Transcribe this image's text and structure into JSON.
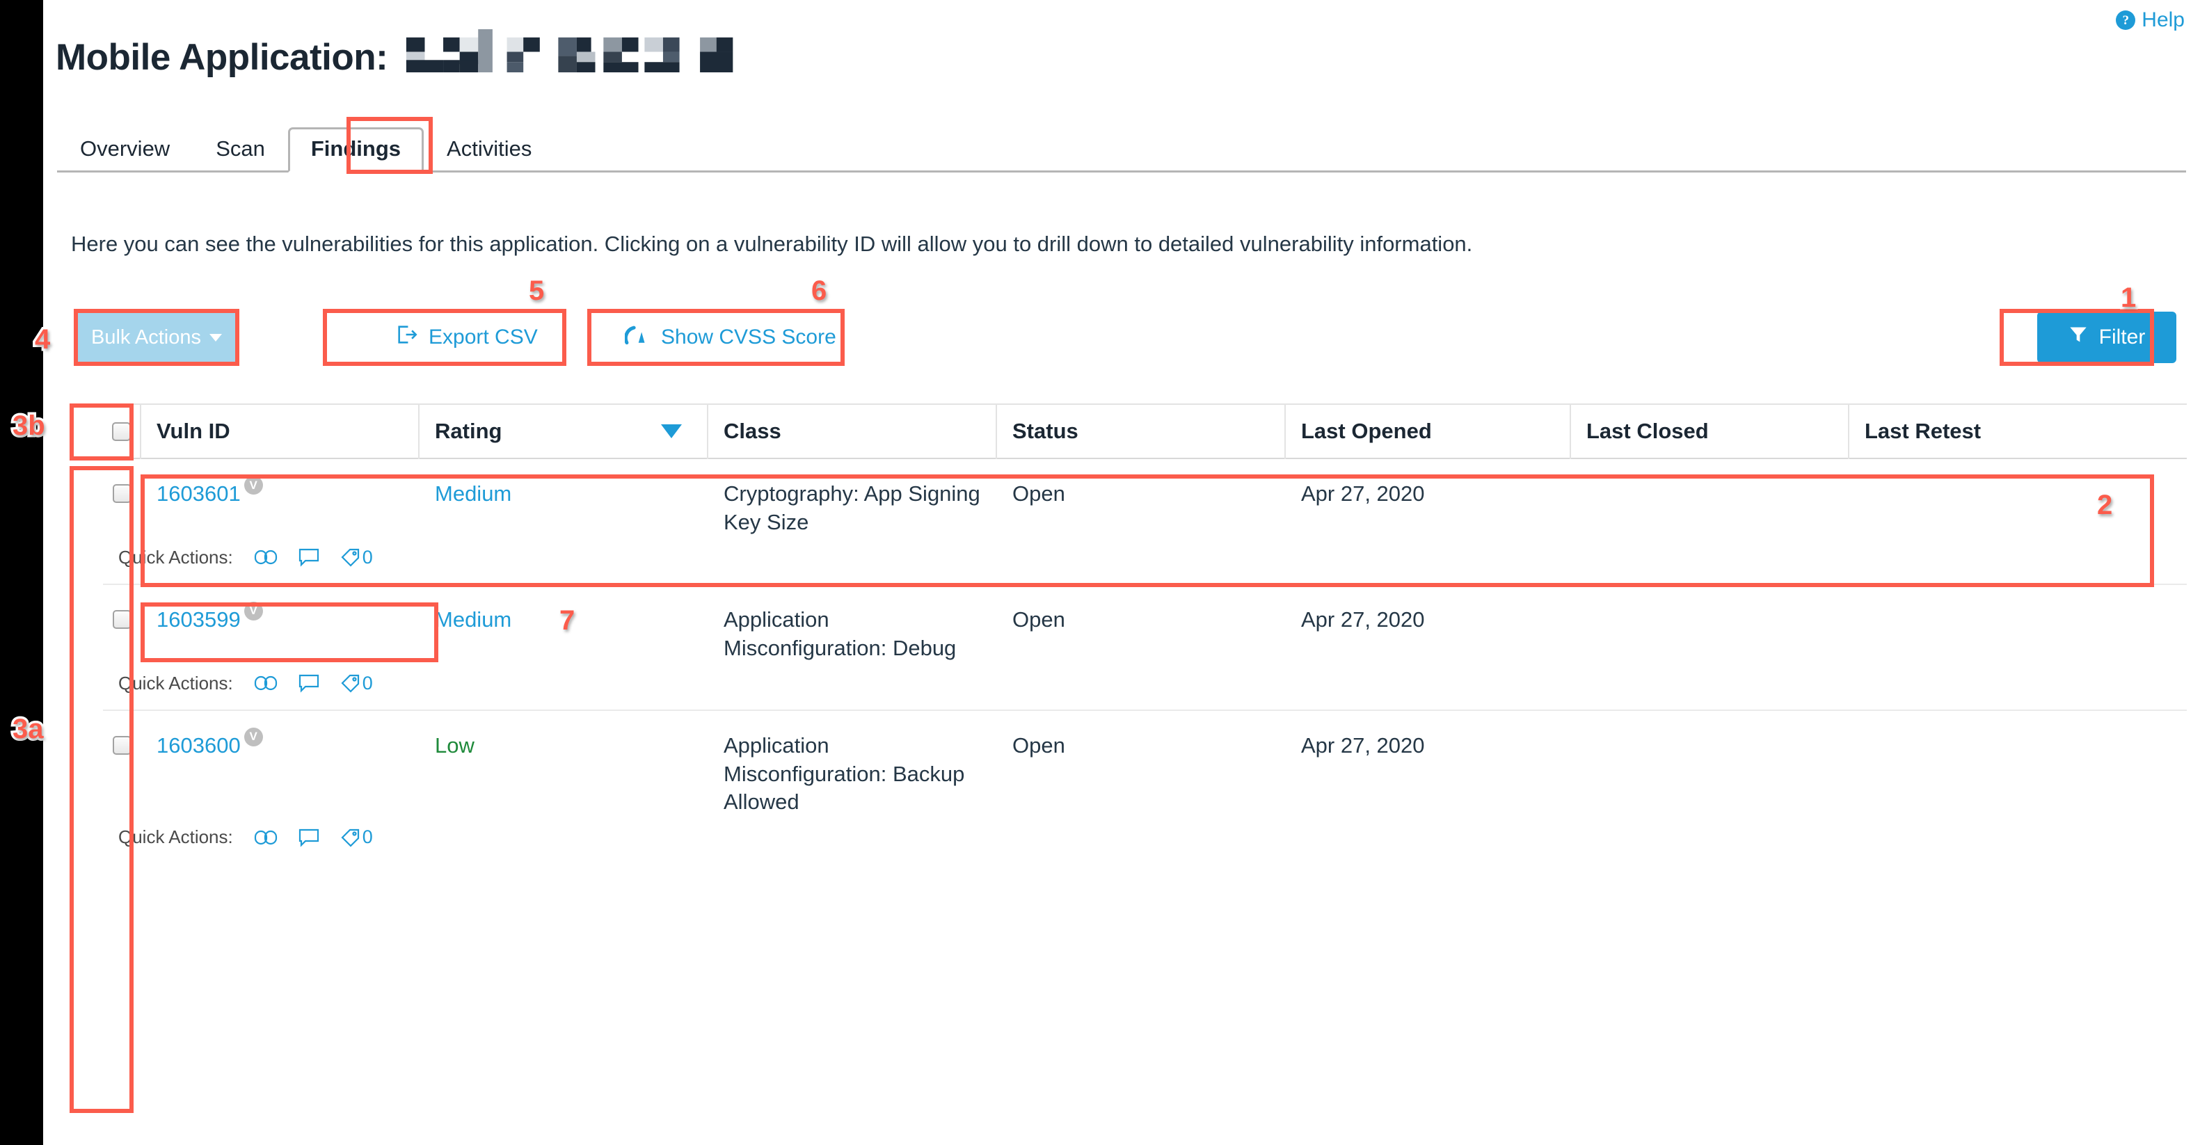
{
  "header": {
    "title_prefix": "Mobile Application:",
    "title_redacted": true,
    "help_label": "Help",
    "help_icon": "question-circle-icon"
  },
  "tabs": [
    {
      "label": "Overview",
      "active": false
    },
    {
      "label": "Scan",
      "active": false
    },
    {
      "label": "Findings",
      "active": true
    },
    {
      "label": "Activities",
      "active": false
    }
  ],
  "description": "Here you can see the vulnerabilities for this application. Clicking on a vulnerability ID will allow you to drill down to detailed vulnerability information.",
  "toolbar": {
    "bulk_actions_label": "Bulk Actions",
    "bulk_actions_caret": "caret-down-icon",
    "export_csv_label": "Export CSV",
    "export_csv_icon": "export-icon",
    "show_cvss_label": "Show CVSS Score",
    "show_cvss_icon": "speedometer-icon",
    "filter_label": "Filter",
    "filter_icon": "funnel-icon"
  },
  "table": {
    "columns": [
      {
        "key": "checkbox",
        "label": ""
      },
      {
        "key": "vuln_id",
        "label": "Vuln ID"
      },
      {
        "key": "rating",
        "label": "Rating",
        "sorted": true,
        "sort_dir": "desc"
      },
      {
        "key": "class",
        "label": "Class"
      },
      {
        "key": "status",
        "label": "Status"
      },
      {
        "key": "last_opened",
        "label": "Last Opened"
      },
      {
        "key": "last_closed",
        "label": "Last Closed"
      },
      {
        "key": "last_retest",
        "label": "Last Retest"
      }
    ],
    "quick_actions_label": "Quick Actions:",
    "quick_action_icons": [
      "link-icon",
      "comment-icon",
      "tag-icon"
    ],
    "rows": [
      {
        "selected": false,
        "vuln_id": "1603601",
        "badge": "V",
        "rating": "Medium",
        "rating_color": "#1e9bd7",
        "class": "Cryptography: App Signing Key Size",
        "status": "Open",
        "last_opened": "Apr 27, 2020",
        "last_closed": "",
        "last_retest": "",
        "tag_count": "0"
      },
      {
        "selected": false,
        "vuln_id": "1603599",
        "badge": "V",
        "rating": "Medium",
        "rating_color": "#1e9bd7",
        "class": "Application Misconfiguration: Debug",
        "status": "Open",
        "last_opened": "Apr 27, 2020",
        "last_closed": "",
        "last_retest": "",
        "tag_count": "0"
      },
      {
        "selected": false,
        "vuln_id": "1603600",
        "badge": "V",
        "rating": "Low",
        "rating_color": "#1f8a3b",
        "class": "Application Misconfiguration: Backup Allowed",
        "status": "Open",
        "last_opened": "Apr 27, 2020",
        "last_closed": "",
        "last_retest": "",
        "tag_count": "0"
      }
    ]
  },
  "annotations": {
    "color": "#fb5c4c",
    "markers": [
      {
        "id": "1",
        "target": "filter-button"
      },
      {
        "id": "2",
        "target": "findings-row"
      },
      {
        "id": "3a",
        "target": "row-checkbox-column"
      },
      {
        "id": "3b",
        "target": "select-all-checkbox"
      },
      {
        "id": "4",
        "target": "bulk-actions-button"
      },
      {
        "id": "5",
        "target": "export-csv-button"
      },
      {
        "id": "6",
        "target": "show-cvss-score-button"
      },
      {
        "id": "7",
        "target": "quick-actions-row"
      }
    ]
  }
}
